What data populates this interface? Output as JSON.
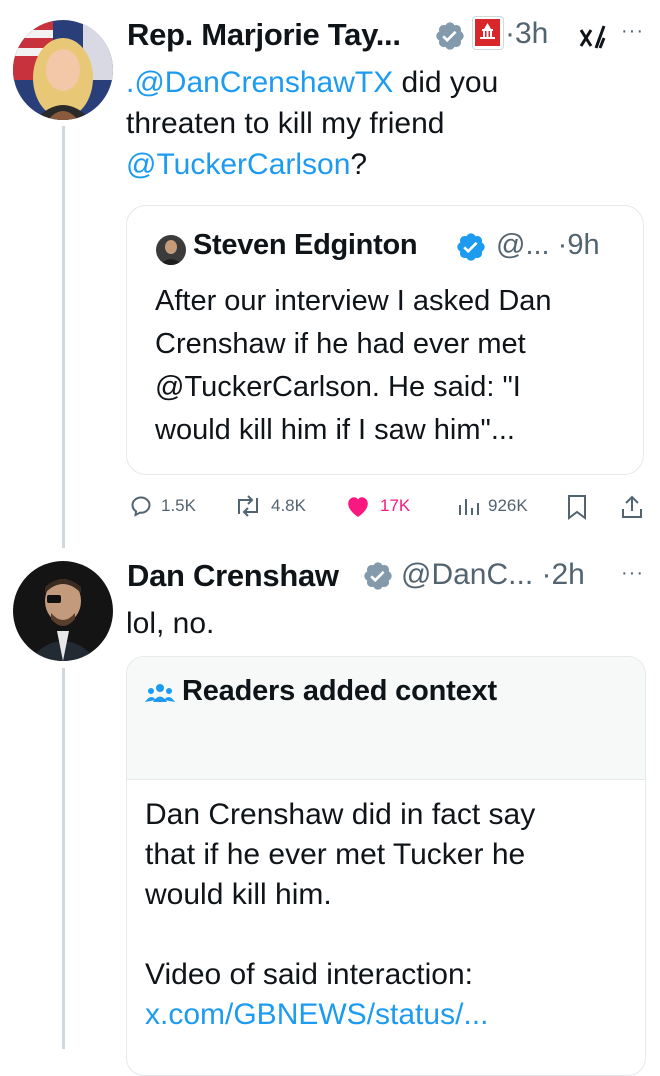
{
  "tweet1": {
    "author_name": "Rep. Marjorie Tay...",
    "time": "·3h",
    "text_parts": {
      "mention1": ".@DanCrenshawTX",
      "line1_rest": " did you",
      "line2": "threaten to kill my friend",
      "mention2": "@TuckerCarlson",
      "line3_rest": "?"
    }
  },
  "quote": {
    "author_name": "Steven Edginton",
    "handle_time": "@... ·9h",
    "text_lines": [
      "After our interview I asked Dan",
      "Crenshaw if he had ever met",
      "@TuckerCarlson. He said: \"I",
      "would kill him if I saw him\"..."
    ]
  },
  "actions": {
    "replies": "1.5K",
    "reposts": "4.8K",
    "likes": "17K",
    "views": "926K"
  },
  "tweet2": {
    "author_name": "Dan Crenshaw",
    "handle_time": "@DanC... ·2h",
    "text": "lol, no."
  },
  "community_note": {
    "title": "Readers added context",
    "body_lines": [
      "Dan Crenshaw did in fact say",
      "that if he ever met Tucker he",
      "would kill him."
    ],
    "video_label": "Video of said interaction:",
    "link": "x.com/GBNEWS/status/..."
  },
  "colors": {
    "link": "#1d9bf0",
    "verified_gray": "#829aab",
    "verified_blue": "#1d9bf0",
    "like_pink": "#f91880",
    "text_secondary": "#536471"
  }
}
